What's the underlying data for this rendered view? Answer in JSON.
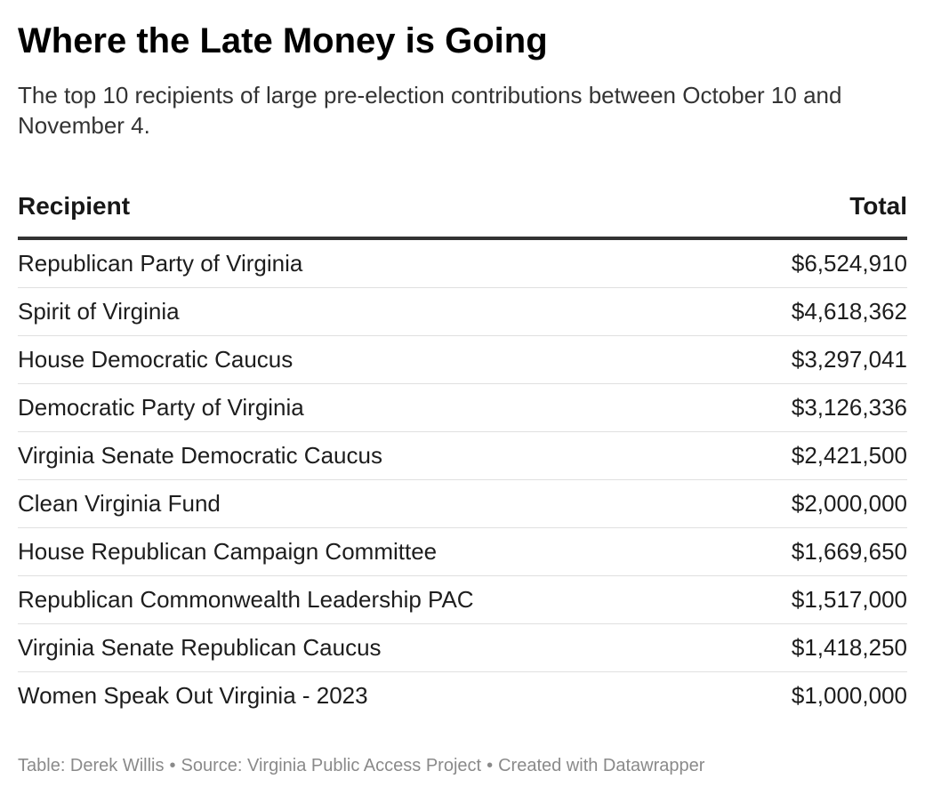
{
  "title": "Where the Late Money is Going",
  "subtitle": "The top 10 recipients of large pre-election contributions between October 10 and November 4.",
  "chart_data": {
    "type": "table",
    "columns": [
      "Recipient",
      "Total"
    ],
    "rows": [
      {
        "recipient": "Republican Party of Virginia",
        "total": "$6,524,910",
        "value": 6524910
      },
      {
        "recipient": "Spirit of Virginia",
        "total": "$4,618,362",
        "value": 4618362
      },
      {
        "recipient": "House Democratic Caucus",
        "total": "$3,297,041",
        "value": 3297041
      },
      {
        "recipient": "Democratic Party of Virginia",
        "total": "$3,126,336",
        "value": 3126336
      },
      {
        "recipient": "Virginia Senate Democratic Caucus",
        "total": "$2,421,500",
        "value": 2421500
      },
      {
        "recipient": "Clean Virginia Fund",
        "total": "$2,000,000",
        "value": 2000000
      },
      {
        "recipient": "House Republican Campaign Committee",
        "total": "$1,669,650",
        "value": 1669650
      },
      {
        "recipient": "Republican Commonwealth Leadership PAC",
        "total": "$1,517,000",
        "value": 1517000
      },
      {
        "recipient": "Virginia Senate Republican Caucus",
        "total": "$1,418,250",
        "value": 1418250
      },
      {
        "recipient": "Women Speak Out Virginia - 2023",
        "total": "$1,000,000",
        "value": 1000000
      }
    ]
  },
  "footer": {
    "table_credit": "Table: Derek Willis",
    "source": "Source: Virginia Public Access Project",
    "created_with": "Created with Datawrapper",
    "separator": "•"
  },
  "colors": {
    "text": "#181818",
    "rule": "#333333",
    "row_divider": "#e0e0e0",
    "footer_text": "#8a8a8a"
  }
}
